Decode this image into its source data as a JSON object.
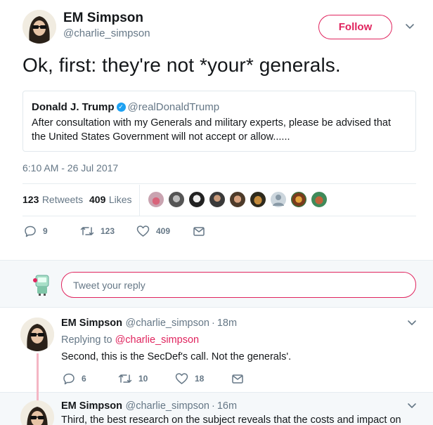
{
  "tweet": {
    "author_name": "EM Simpson",
    "author_handle": "@charlie_simpson",
    "follow_label": "Follow",
    "text": "Ok, first: they're not *your* generals.",
    "quoted": {
      "name": "Donald J. Trump",
      "handle": "@realDonaldTrump",
      "body": "After consultation with my Generals and military experts, please be advised that the United States Government will not accept or allow......"
    },
    "timestamp": "6:10 AM - 26 Jul 2017",
    "stats": {
      "retweets_count": "123",
      "retweets_label": "Retweets",
      "likes_count": "409",
      "likes_label": "Likes"
    },
    "likers": [
      "pink-lips-avatar",
      "grey-face-avatar",
      "bw-face-avatar",
      "man-avatar",
      "smiling-man-avatar",
      "cat-avatar",
      "default-avatar",
      "colorful-avatar",
      "red-beard-avatar"
    ],
    "actions": {
      "replies": "9",
      "retweets": "123",
      "likes": "409"
    }
  },
  "reply_box": {
    "placeholder": "Tweet your reply"
  },
  "replies": [
    {
      "name": "EM Simpson",
      "handle": "@charlie_simpson",
      "dot": "·",
      "time": "18m",
      "replying_prefix": "Replying to",
      "replying_to": "@charlie_simpson",
      "text": "Second, this is the SecDef's call. Not the generals'.",
      "reply_count": "6",
      "retweet_count": "10",
      "like_count": "18"
    },
    {
      "name": "EM Simpson",
      "handle": "@charlie_simpson",
      "dot": "·",
      "time": "16m",
      "text": "Third, the best research on the subject reveals that the costs and impact on"
    }
  ],
  "colors": {
    "accent": "#e0245e",
    "muted": "#657786",
    "verified": "#1da1f2"
  }
}
